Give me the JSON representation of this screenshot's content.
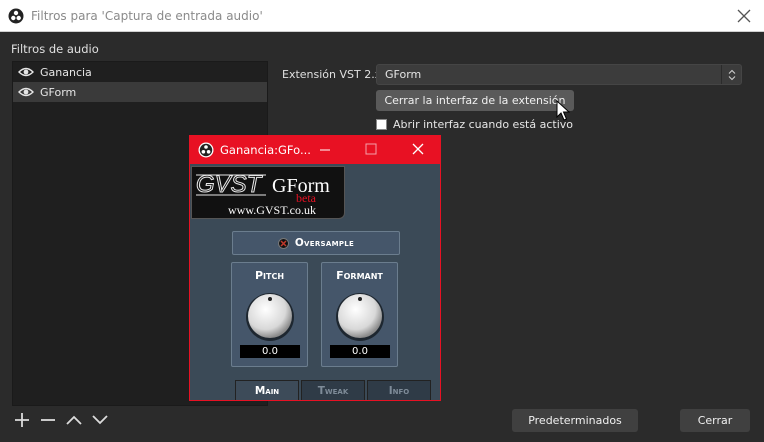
{
  "window": {
    "title": "Filtros para 'Captura de entrada audio'",
    "app_icon": "obs-icon",
    "close_icon": "close-icon"
  },
  "filters": {
    "section_label": "Filtros de audio",
    "items": [
      {
        "label": "Ganancia",
        "icon": "eye-icon",
        "selected": false
      },
      {
        "label": "GForm",
        "icon": "eye-icon",
        "selected": true
      }
    ]
  },
  "plugin": {
    "label": "Extensión VST 2.x",
    "selected_value": "GForm",
    "close_interface_label": "Cerrar la interfaz de la extensión",
    "open_interface_label": "Abrir interfaz cuando está activo",
    "open_interface_checked": false
  },
  "footer": {
    "add_icon": "plus-icon",
    "remove_icon": "minus-icon",
    "up_icon": "chevron-up-icon",
    "down_icon": "chevron-down-icon",
    "defaults_label": "Predeterminados",
    "close_label": "Cerrar"
  },
  "plugin_window": {
    "title": "Ganancia:GFo...",
    "accent": "#e81123",
    "logo": {
      "brand": "GVST",
      "product": "GForm",
      "tag": "beta",
      "site": "www.GVST.co.uk"
    },
    "oversample_label": "Oversample",
    "pitch": {
      "label": "Pitch",
      "value": "0.0"
    },
    "formant": {
      "label": "Formant",
      "value": "0.0"
    },
    "tabs": [
      {
        "label": "Main",
        "active": true
      },
      {
        "label": "Tweak",
        "active": false
      },
      {
        "label": "Info",
        "active": false
      }
    ]
  }
}
